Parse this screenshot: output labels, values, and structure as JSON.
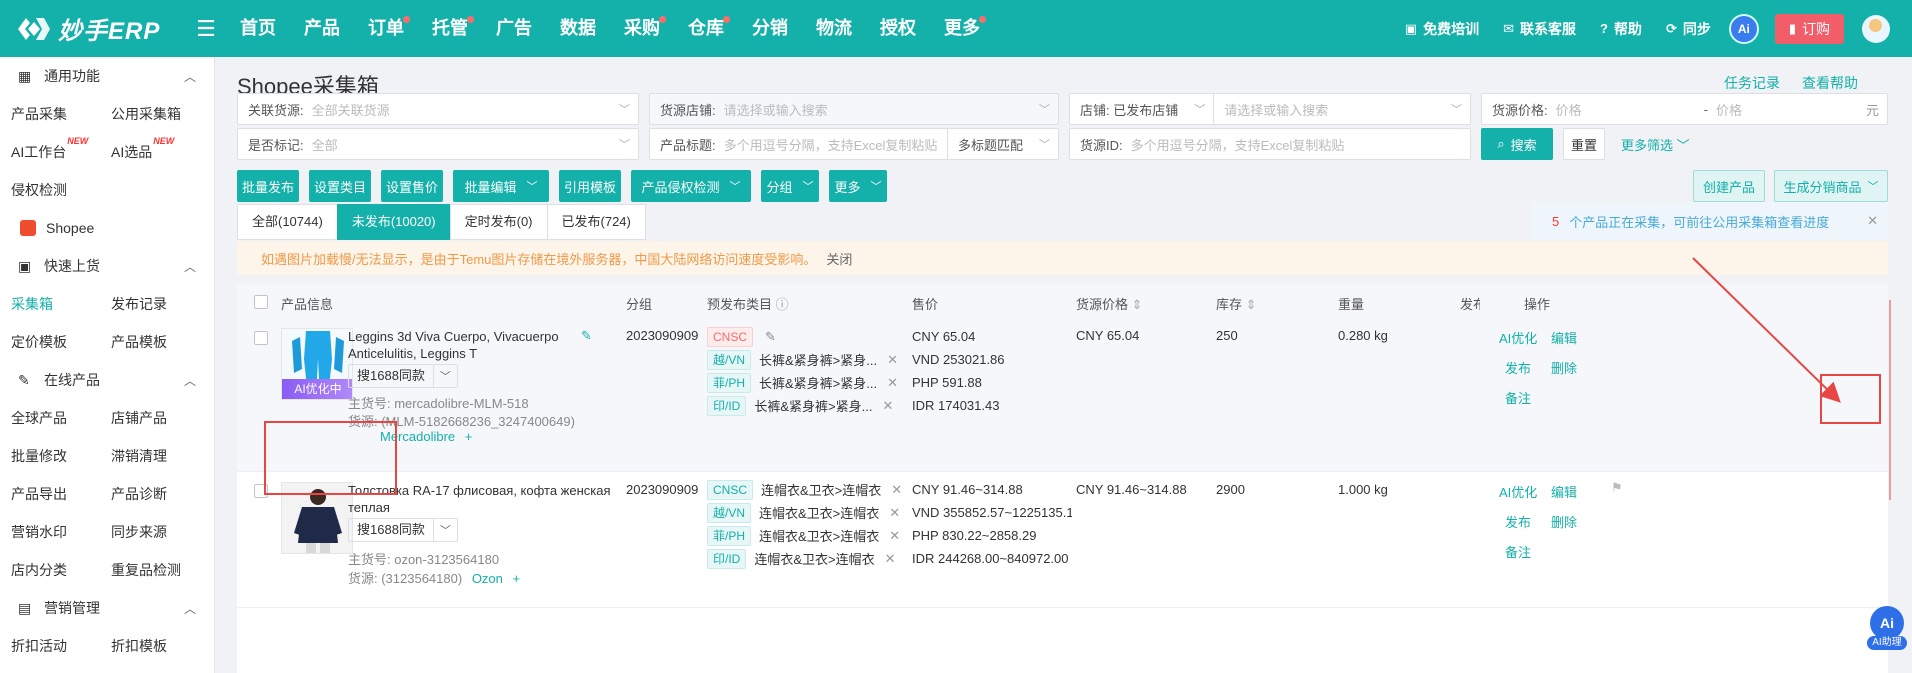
{
  "logo": {
    "text": "妙手ERP"
  },
  "nav": [
    {
      "label": "首页",
      "dot": false
    },
    {
      "label": "产品",
      "dot": false
    },
    {
      "label": "订单",
      "dot": true
    },
    {
      "label": "托管",
      "dot": true
    },
    {
      "label": "广告",
      "dot": false
    },
    {
      "label": "数据",
      "dot": false
    },
    {
      "label": "采购",
      "dot": true
    },
    {
      "label": "仓库",
      "dot": true
    },
    {
      "label": "分销",
      "dot": false
    },
    {
      "label": "物流",
      "dot": false
    },
    {
      "label": "授权",
      "dot": false
    },
    {
      "label": "更多",
      "dot": true
    }
  ],
  "topright": {
    "training": "免费培训",
    "service": "联系客服",
    "help": "帮助",
    "sync": "同步",
    "ai": "Ai",
    "order": "订购"
  },
  "sidebar": {
    "group1": "通用功能",
    "r1": [
      "产品采集",
      "公用采集箱"
    ],
    "r2": [
      "AI工作台",
      "AI选品"
    ],
    "new_tag": "NEW",
    "r3": [
      "侵权检测"
    ],
    "shopee": "Shopee",
    "group2": "快速上货",
    "r4": [
      "采集箱",
      "发布记录"
    ],
    "r5": [
      "定价模板",
      "产品模板"
    ],
    "group3": "在线产品",
    "r6": [
      "全球产品",
      "店铺产品"
    ],
    "r7": [
      "批量修改",
      "滞销清理"
    ],
    "r8": [
      "产品导出",
      "产品诊断"
    ],
    "r9": [
      "营销水印",
      "同步来源"
    ],
    "r10": [
      "店内分类",
      "重复品检测"
    ],
    "group4": "营销管理",
    "r11": [
      "折扣活动",
      "折扣模板"
    ]
  },
  "page": {
    "title": "Shopee采集箱",
    "task_log": "任务记录",
    "view_help": "查看帮助"
  },
  "filters": {
    "rel_source_label": "关联货源:",
    "rel_source_ph": "全部关联货源",
    "source_shop_label": "货源店铺:",
    "source_shop_ph": "请选择或输入搜索",
    "shop_label": "店铺: 已发布店铺",
    "shop_ph": "请选择或输入搜索",
    "price_label": "货源价格:",
    "price_min_ph": "价格",
    "price_sep": "-",
    "price_max_ph": "价格",
    "price_unit": "元",
    "marked_label": "是否标记:",
    "marked_ph": "全部",
    "title_label": "产品标题:",
    "title_ph": "多个用逗号分隔，支持Excel复制粘贴",
    "title_match": "多标题匹配",
    "source_id_label": "货源ID:",
    "source_id_ph": "多个用逗号分隔，支持Excel复制粘贴",
    "search": "搜索",
    "reset": "重置",
    "more": "更多筛选"
  },
  "toolbar": {
    "batch_publish": "批量发布",
    "set_category": "设置类目",
    "set_price": "设置售价",
    "batch_edit": "批量编辑",
    "use_template": "引用模板",
    "infringe_check": "产品侵权检测",
    "group": "分组",
    "more": "更多",
    "create_product": "创建产品",
    "gen_distribution": "生成分销商品"
  },
  "tabs": [
    {
      "label": "全部(10744)",
      "active": false
    },
    {
      "label": "未发布(10020)",
      "active": true
    },
    {
      "label": "定时发布(0)",
      "active": false
    },
    {
      "label": "已发布(724)",
      "active": false
    }
  ],
  "notice": {
    "count": "5",
    "text": "个产品正在采集，可前往公用采集箱查看进度"
  },
  "warning": {
    "text": "如遇图片加载慢/无法显示，是由于Temu图片存储在境外服务器，中国大陆网络访问速度受影响。",
    "close": "关闭"
  },
  "table": {
    "headers": {
      "info": "产品信息",
      "group": "分组",
      "category": "预发布类目",
      "price": "售价",
      "source_price": "货源价格",
      "stock": "库存",
      "weight": "重量",
      "publish": "发布",
      "ops": "操作"
    },
    "rows": [
      {
        "title1": "Leggins 3d Viva Cuerpo, Vivacuerpo",
        "title2": "Anticelulitis, Leggins T",
        "ai_badge": "AI优化中",
        "search_btn": "搜1688同款",
        "main_sku": "主货号:  mercadolibre-MLM-518",
        "source": "货源:  (MLM-5182668236_3247400649)",
        "platform": "Mercadolibre",
        "group": "2023090909",
        "cats": [
          {
            "tag": "CNSC",
            "cat": ""
          },
          {
            "tag": "越/VN",
            "cat": "长裤&紧身裤>紧身..."
          },
          {
            "tag": "菲/PH",
            "cat": "长裤&紧身裤>紧身..."
          },
          {
            "tag": "印/ID",
            "cat": "长裤&紧身裤>紧身..."
          }
        ],
        "prices": [
          "CNY  65.04",
          "VND  253021.86",
          "PHP  591.88",
          "IDR  174031.43"
        ],
        "source_price": "CNY 65.04",
        "stock": "250",
        "weight": "0.280 kg",
        "ops": {
          "ai": "AI优化",
          "edit": "编辑",
          "publish": "发布",
          "delete": "删除",
          "note": "备注"
        }
      },
      {
        "title1": "Толстовка RA-17 флисовая, кофта женская",
        "title2": "теплая",
        "search_btn": "搜1688同款",
        "main_sku": "主货号:  ozon-3123564180",
        "source": "货源:  (3123564180)",
        "platform": "Ozon",
        "group": "2023090909",
        "cats": [
          {
            "tag": "CNSC",
            "cat": "连帽衣&卫衣>连帽衣"
          },
          {
            "tag": "越/VN",
            "cat": "连帽衣&卫衣>连帽衣"
          },
          {
            "tag": "菲/PH",
            "cat": "连帽衣&卫衣>连帽衣"
          },
          {
            "tag": "印/ID",
            "cat": "连帽衣&卫衣>连帽衣"
          }
        ],
        "prices": [
          "CNY  91.46~314.88",
          "VND  355852.57~1225135.10",
          "PHP  830.22~2858.29",
          "IDR  244268.00~840972.00"
        ],
        "source_price": "CNY 91.46~314.88",
        "stock": "2900",
        "weight": "1.000 kg",
        "ops": {
          "ai": "AI优化",
          "edit": "编辑",
          "publish": "发布",
          "delete": "删除",
          "note": "备注"
        }
      }
    ]
  },
  "ai_helper": "AI助理",
  "colors": {
    "brand": "#14b0aa",
    "annotation": "#e84545"
  }
}
